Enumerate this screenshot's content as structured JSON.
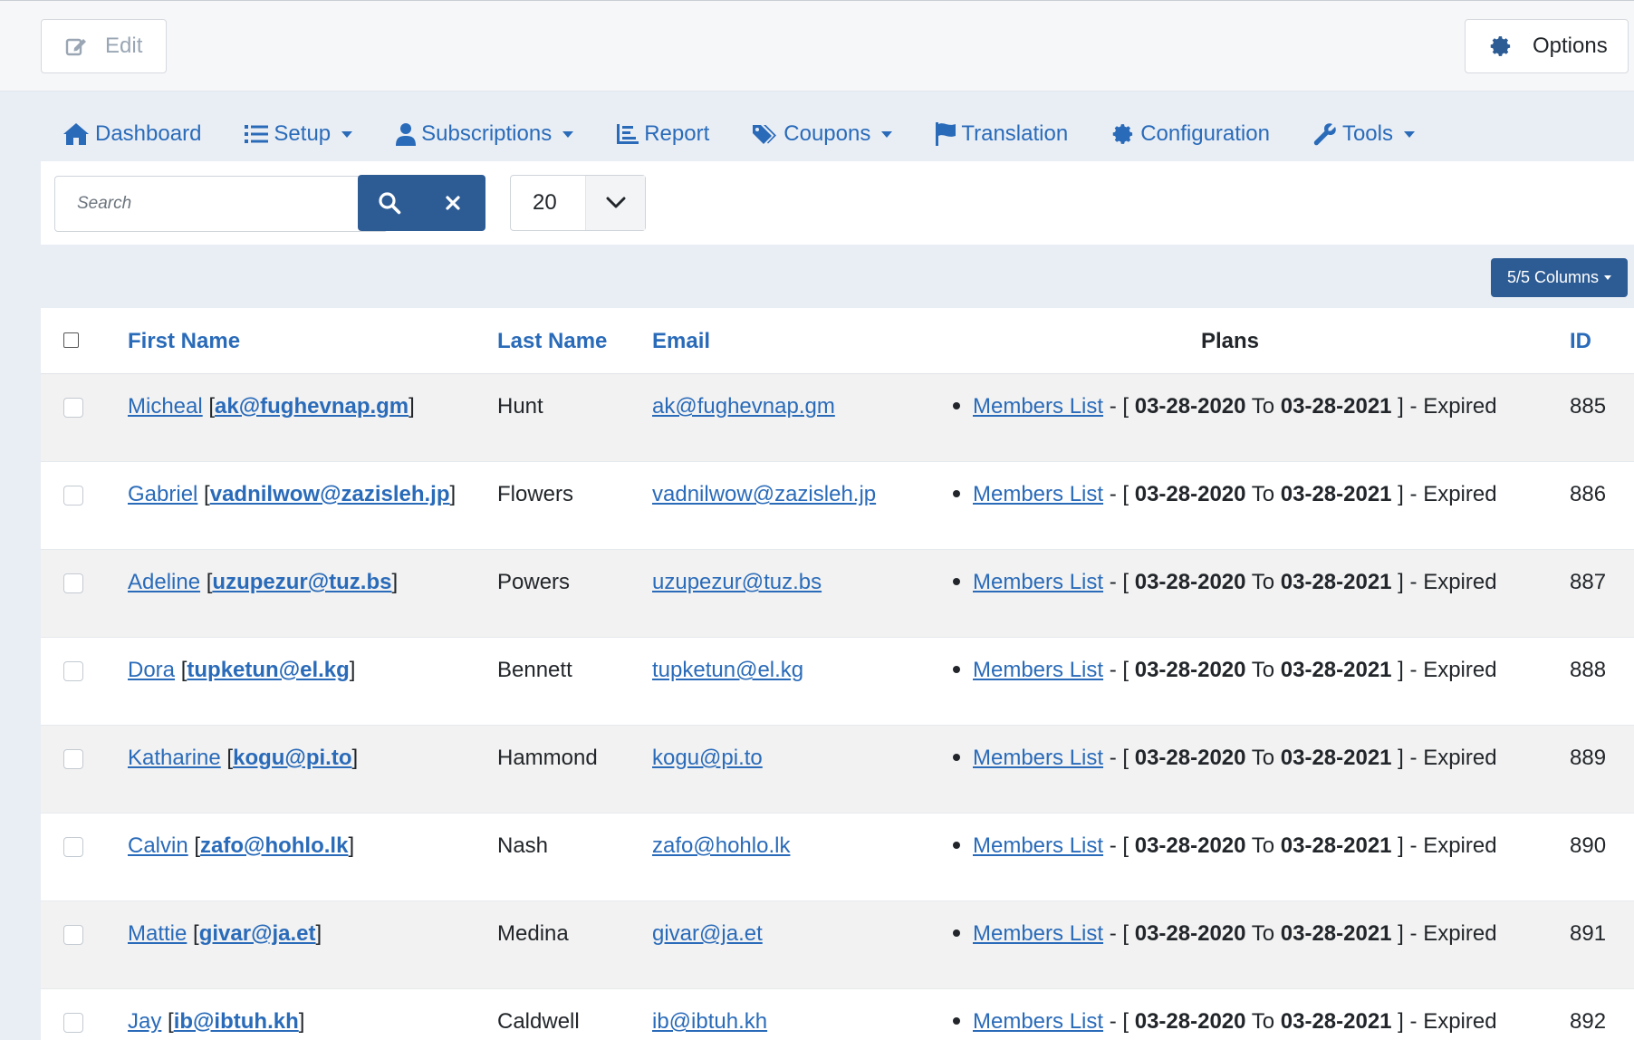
{
  "toolbar": {
    "edit_label": "Edit",
    "options_label": "Options"
  },
  "nav": {
    "items": [
      {
        "label": "Dashboard",
        "icon": "home-icon"
      },
      {
        "label": "Setup",
        "icon": "list-icon"
      },
      {
        "label": "Subscriptions",
        "icon": "user-icon"
      },
      {
        "label": "Report",
        "icon": "chart-icon"
      },
      {
        "label": "Coupons",
        "icon": "tags-icon"
      },
      {
        "label": "Translation",
        "icon": "flag-icon"
      },
      {
        "label": "Configuration",
        "icon": "gear-icon"
      },
      {
        "label": "Tools",
        "icon": "wrench-icon"
      }
    ]
  },
  "filter": {
    "search_placeholder": "Search",
    "search_value": "",
    "limit_value": "20"
  },
  "columns_button": {
    "label": "5/5 Columns"
  },
  "table": {
    "headers": {
      "first_name": "First Name",
      "last_name": "Last Name",
      "email": "Email",
      "plans": "Plans",
      "id": "ID"
    },
    "rows": [
      {
        "first": "Micheal",
        "email": "ak@fughevnap.gm",
        "last": "Hunt",
        "plan": "Members List",
        "from": "03-28-2020",
        "to": "03-28-2021",
        "status": "Expired",
        "id": "885"
      },
      {
        "first": "Gabriel",
        "email": "vadnilwow@zazisleh.jp",
        "last": "Flowers",
        "plan": "Members List",
        "from": "03-28-2020",
        "to": "03-28-2021",
        "status": "Expired",
        "id": "886"
      },
      {
        "first": "Adeline",
        "email": "uzupezur@tuz.bs",
        "last": "Powers",
        "plan": "Members List",
        "from": "03-28-2020",
        "to": "03-28-2021",
        "status": "Expired",
        "id": "887"
      },
      {
        "first": "Dora",
        "email": "tupketun@el.kg",
        "last": "Bennett",
        "plan": "Members List",
        "from": "03-28-2020",
        "to": "03-28-2021",
        "status": "Expired",
        "id": "888"
      },
      {
        "first": "Katharine",
        "email": "kogu@pi.to",
        "last": "Hammond",
        "plan": "Members List",
        "from": "03-28-2020",
        "to": "03-28-2021",
        "status": "Expired",
        "id": "889"
      },
      {
        "first": "Calvin",
        "email": "zafo@hohlo.lk",
        "last": "Nash",
        "plan": "Members List",
        "from": "03-28-2020",
        "to": "03-28-2021",
        "status": "Expired",
        "id": "890"
      },
      {
        "first": "Mattie",
        "email": "givar@ja.et",
        "last": "Medina",
        "plan": "Members List",
        "from": "03-28-2020",
        "to": "03-28-2021",
        "status": "Expired",
        "id": "891"
      },
      {
        "first": "Jay",
        "email": "ib@ibtuh.kh",
        "last": "Caldwell",
        "plan": "Members List",
        "from": "03-28-2020",
        "to": "03-28-2021",
        "status": "Expired",
        "id": "892"
      }
    ],
    "plan_connector": "To"
  },
  "colors": {
    "accent": "#2a6bb9",
    "button_bg": "#2d5c94",
    "row_alt": "#f2f2f2"
  }
}
